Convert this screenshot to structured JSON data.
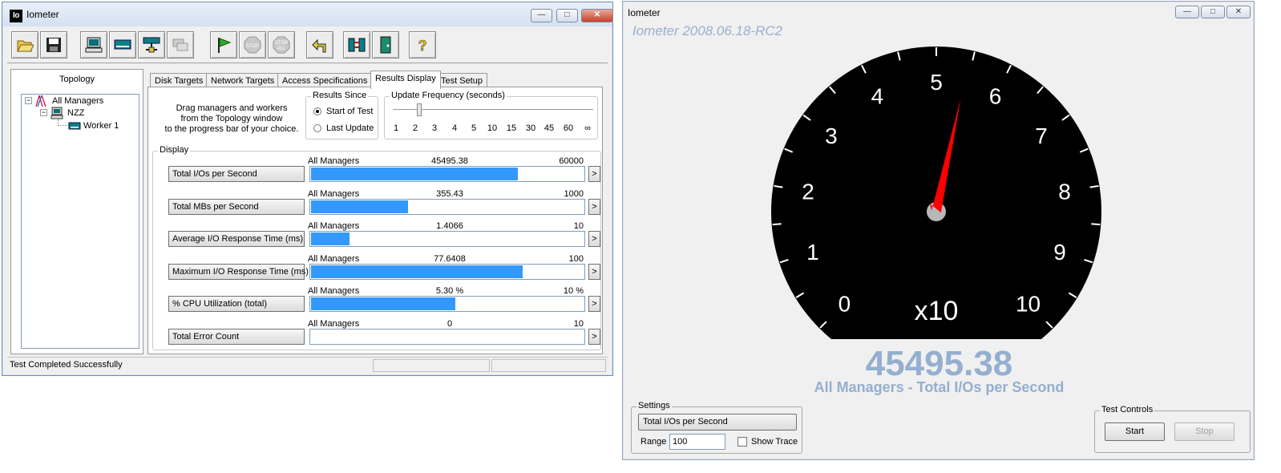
{
  "main_window": {
    "title": "Iometer",
    "logo_text": "Io",
    "topology_label": "Topology",
    "tree": {
      "root": "All Managers",
      "manager": "NZZ",
      "worker": "Worker 1"
    },
    "tabs": [
      "Disk Targets",
      "Network Targets",
      "Access Specifications",
      "Results Display",
      "Test Setup"
    ],
    "active_tab": "Results Display",
    "drag_hint": "Drag managers and workers\nfrom the Topology window\nto the progress bar of your choice.",
    "results_since": {
      "label": "Results Since",
      "start_of_test": "Start of Test",
      "last_update": "Last Update",
      "selected": "Start of Test"
    },
    "update_frequency": {
      "label": "Update Frequency (seconds)",
      "ticks": [
        "1",
        "2",
        "3",
        "4",
        "5",
        "10",
        "15",
        "30",
        "45",
        "60",
        "∞"
      ],
      "selected_index": 1
    },
    "display_label": "Display",
    "rows": [
      {
        "button": "Total I/Os per Second",
        "source": "All Managers",
        "value": "45495.38",
        "max": "60000",
        "fill": 0.758
      },
      {
        "button": "Total MBs per Second",
        "source": "All Managers",
        "value": "355.43",
        "max": "1000",
        "fill": 0.355
      },
      {
        "button": "Average I/O Response Time (ms)",
        "source": "All Managers",
        "value": "1.4066",
        "max": "10",
        "fill": 0.1407
      },
      {
        "button": "Maximum I/O Response Time (ms)",
        "source": "All Managers",
        "value": "77.6408",
        "max": "100",
        "fill": 0.776
      },
      {
        "button": "% CPU Utilization (total)",
        "source": "All Managers",
        "value": "5.30 %",
        "max": "10 %",
        "fill": 0.53
      },
      {
        "button": "Total Error Count",
        "source": "All Managers",
        "value": "0",
        "max": "10",
        "fill": 0
      }
    ],
    "arrow_label": ">",
    "status": "Test Completed Successfully"
  },
  "gauge_window": {
    "title": "Iometer",
    "version": "Iometer 2008.06.18-RC2",
    "dial_numbers": [
      "0",
      "1",
      "2",
      "3",
      "4",
      "5",
      "6",
      "7",
      "8",
      "9",
      "10"
    ],
    "multiplier": "x10",
    "needle_value": 4.55,
    "reading": "45495.38",
    "reading_label": "All Managers - Total I/Os per Second",
    "settings": {
      "label": "Settings",
      "metric": "Total I/Os per Second",
      "range_label": "Range",
      "range_value": "100",
      "show_trace_label": "Show Trace",
      "show_trace_checked": false
    },
    "test_controls": {
      "label": "Test Controls",
      "start": "Start",
      "stop": "Stop"
    }
  },
  "colors": {
    "bar": "#3399ff",
    "gauge_face": "#000000",
    "needle": "#ff0000",
    "reading": "#94afd0",
    "version": "#9aaed0"
  },
  "icons": [
    "open-folder-icon",
    "save-disk-icon",
    "new-manager-icon",
    "disk-worker-icon",
    "network-worker-icon",
    "duplicate-worker-icon",
    "start-flag-icon",
    "stop-icon",
    "stop-all-icon",
    "reset-icon",
    "disconnect-icon",
    "exit-icon",
    "help-icon"
  ]
}
